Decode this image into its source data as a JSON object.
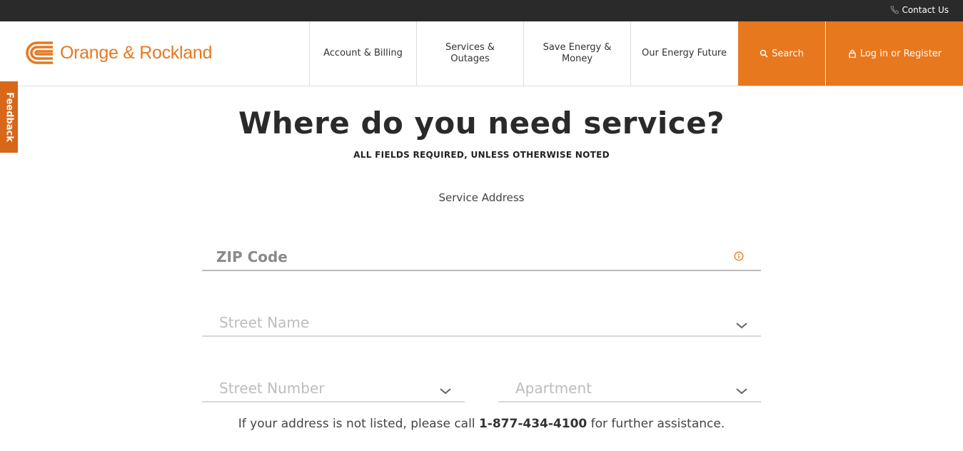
{
  "topbar": {
    "contact_label": "Contact Us"
  },
  "brand": {
    "name": "Orange & Rockland",
    "accent_color": "#e8781e"
  },
  "nav": {
    "items": [
      {
        "label": "Account & Billing"
      },
      {
        "label": "Services & Outages"
      },
      {
        "label": "Save Energy & Money"
      },
      {
        "label": "Our Energy Future"
      }
    ],
    "search_label": "Search",
    "login_label": "Log in or Register"
  },
  "feedback": {
    "label": "Feedback"
  },
  "page": {
    "title": "Where do you need service?",
    "subtitle": "ALL FIELDS REQUIRED, UNLESS OTHERWISE NOTED",
    "section_label": "Service Address"
  },
  "form": {
    "zip_placeholder": "ZIP Code",
    "street_placeholder": "Street Name",
    "number_placeholder": "Street Number",
    "apartment_placeholder": "Apartment"
  },
  "help": {
    "prefix": "If your address is not listed, please call",
    "phone": "1-877-434-4100",
    "suffix": "for further assistance."
  }
}
